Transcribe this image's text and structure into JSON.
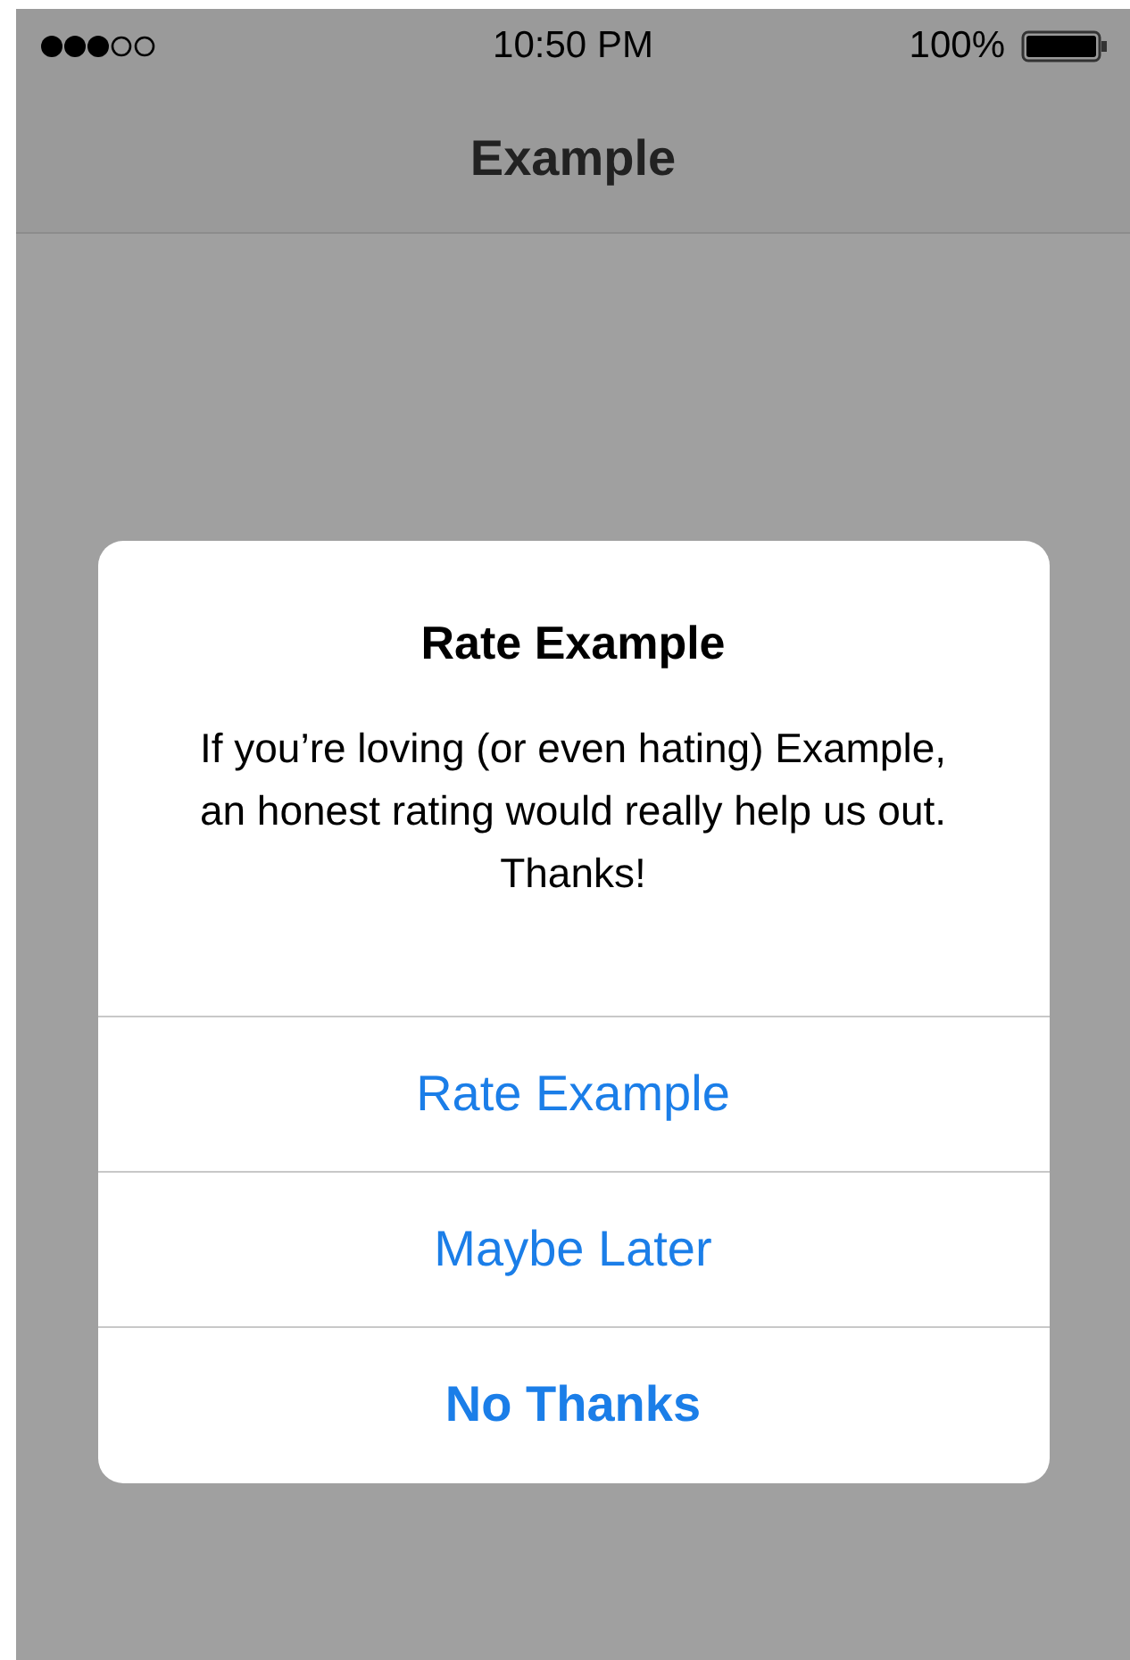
{
  "status_bar": {
    "time": "10:50 PM",
    "battery": "100%"
  },
  "nav_bar": {
    "title": "Example"
  },
  "alert": {
    "title": "Rate Example",
    "message": "If you’re loving (or even hating) Example, an honest rating would really help us out. Thanks!",
    "buttons": [
      {
        "label": "Rate Example",
        "kind": "default"
      },
      {
        "label": "Maybe Later",
        "kind": "default"
      },
      {
        "label": "No Thanks",
        "kind": "cancel"
      }
    ]
  }
}
